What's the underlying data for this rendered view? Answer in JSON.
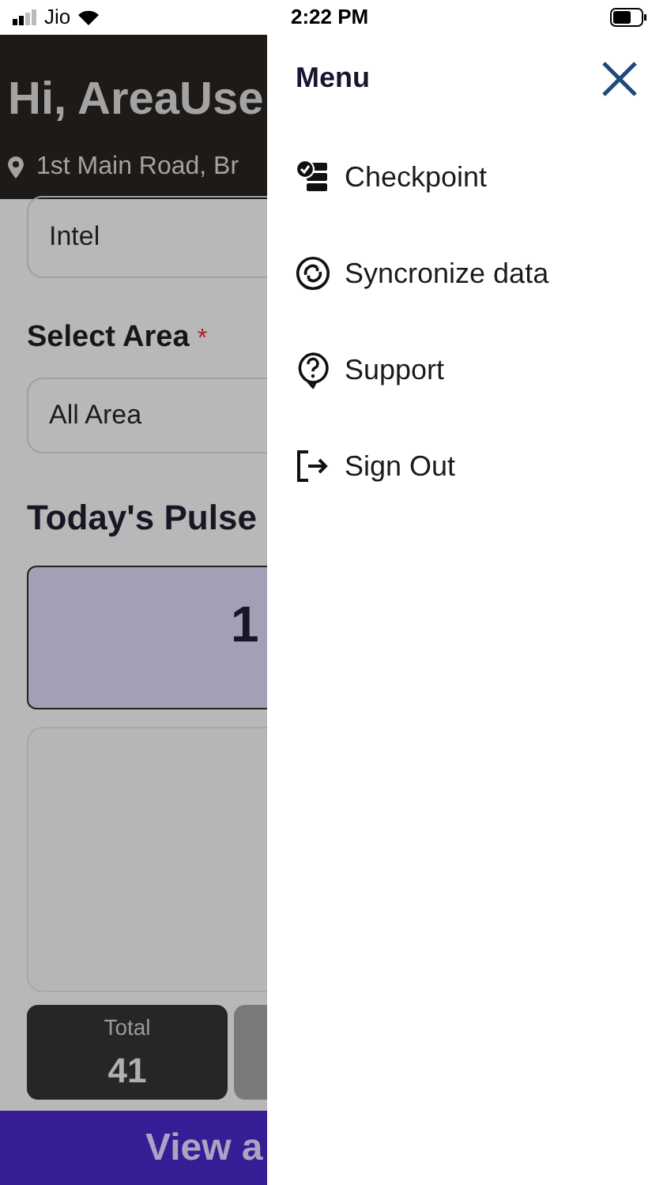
{
  "status_bar": {
    "carrier": "Jio",
    "time": "2:22 PM"
  },
  "background": {
    "greeting": "Hi, AreaUse",
    "location": "1st Main Road, Br",
    "company_field": {
      "value": "Intel"
    },
    "area_label": "Select Area",
    "required_mark": "*",
    "area_field": {
      "value": "All Area"
    },
    "section_title": "Today's Pulse",
    "pulse_value": "1",
    "stats": [
      {
        "label": "Total",
        "value": "41"
      }
    ],
    "bottom_button": "View a"
  },
  "menu": {
    "title": "Menu",
    "items": [
      {
        "kind": "checkpoint",
        "label": "Checkpoint"
      },
      {
        "kind": "sync",
        "label": "Syncronize data"
      },
      {
        "kind": "support",
        "label": "Support"
      },
      {
        "kind": "signout",
        "label": "Sign Out"
      }
    ]
  }
}
